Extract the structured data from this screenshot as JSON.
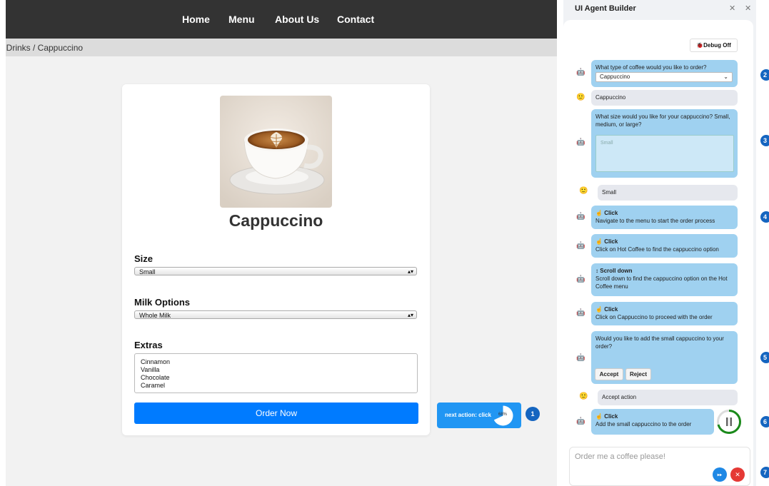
{
  "nav": {
    "items": [
      "Home",
      "Menu",
      "About Us",
      "Contact"
    ],
    "bg_color": "#333333"
  },
  "breadcrumb": {
    "text": "t Drinks / Cappuccino"
  },
  "product": {
    "title": "Cappuccino",
    "size_label": "Size",
    "size_value": "Small",
    "milk_label": "Milk Options",
    "milk_value": "Whole Milk",
    "extras_label": "Extras",
    "extras_options": [
      "Cinnamon",
      "Vanilla",
      "Chocolate",
      "Caramel"
    ],
    "order_button": "Order Now",
    "order_button_color": "#007bff"
  },
  "next_action": {
    "text": "next action: click",
    "percent_label": "68%",
    "progress": 0.68,
    "badge": "1"
  },
  "panel": {
    "title": "UI Agent Builder",
    "pin_icon": "pin-icon",
    "close_icon": "close-icon",
    "debug_button": "🐞Debug Off",
    "messages": {
      "m1_text": "What type of coffee would you like to order?",
      "m1_select": "Cappuccino",
      "m2_user": "Cappuccino",
      "m3_text": "What size would you like for your cappuccino? Small, medium, or large?",
      "m3_placeholder": "Small",
      "m4_user": "Small",
      "m5_head": "Click",
      "m5_text": "Navigate to the menu to start the order process",
      "m6_head": "Click",
      "m6_text": "Click on Hot Coffee to find the cappuccino option",
      "m7_head": "Scroll down",
      "m7_text": "Scroll down to find the cappuccino option on the Hot Coffee menu",
      "m8_head": "Click",
      "m8_text": "Click on Cappuccino to proceed with the order",
      "m9_text": "Would you like to add the small cappuccino to your order?",
      "m9_accept": "Accept",
      "m9_reject": "Reject",
      "m10_user": "Accept action",
      "m11_head": "Click",
      "m11_text": "Add the small cappuccino to the order"
    },
    "input_placeholder": "Order me a coffee please!",
    "send_color": "#1e88e5",
    "stop_color": "#e53935",
    "step_badges": [
      "2",
      "3",
      "4",
      "5",
      "6",
      "7"
    ]
  }
}
